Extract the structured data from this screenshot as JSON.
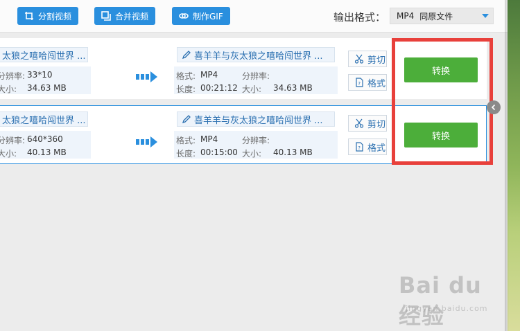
{
  "toolbar": {
    "split_label": "分割视频",
    "merge_label": "合并视频",
    "gif_label": "制作GIF",
    "output_label": "输出格式：",
    "output_format": "MP4",
    "output_dir": "同原文件"
  },
  "rows": [
    {
      "src_name": "太狼之嘻哈闯世界 ...",
      "src_res_label": "分辨率:",
      "src_res": "33*10",
      "src_size_label": "大小:",
      "src_size": "34.63 MB",
      "dst_name": "喜羊羊与灰太狼之嘻哈闯世界 ...",
      "fmt_label": "格式:",
      "fmt": "MP4",
      "res_label": "分辨率:",
      "res": "",
      "len_label": "长度:",
      "len": "00:21:12",
      "size_label": "大小:",
      "size": "34.63 MB",
      "cut_label": "剪切",
      "format_label": "格式",
      "convert_label": "转换"
    },
    {
      "src_name": "太狼之嘻哈闯世界 ...",
      "src_res_label": "分辨率:",
      "src_res": "640*360",
      "src_size_label": "大小:",
      "src_size": "40.13 MB",
      "dst_name": "喜羊羊与灰太狼之嘻哈闯世界 ...",
      "fmt_label": "格式:",
      "fmt": "MP4",
      "res_label": "分辨率:",
      "res": "",
      "len_label": "长度:",
      "len": "00:15:00",
      "size_label": "大小:",
      "size": "40.13 MB",
      "cut_label": "剪切",
      "format_label": "格式",
      "convert_label": "转换"
    }
  ],
  "watermark": {
    "brand": "Bai du 经验",
    "url": "jingyan.baidu.com"
  },
  "colors": {
    "accent": "#2a8fde",
    "convert": "#4cae3a",
    "highlight": "#e8403b"
  }
}
